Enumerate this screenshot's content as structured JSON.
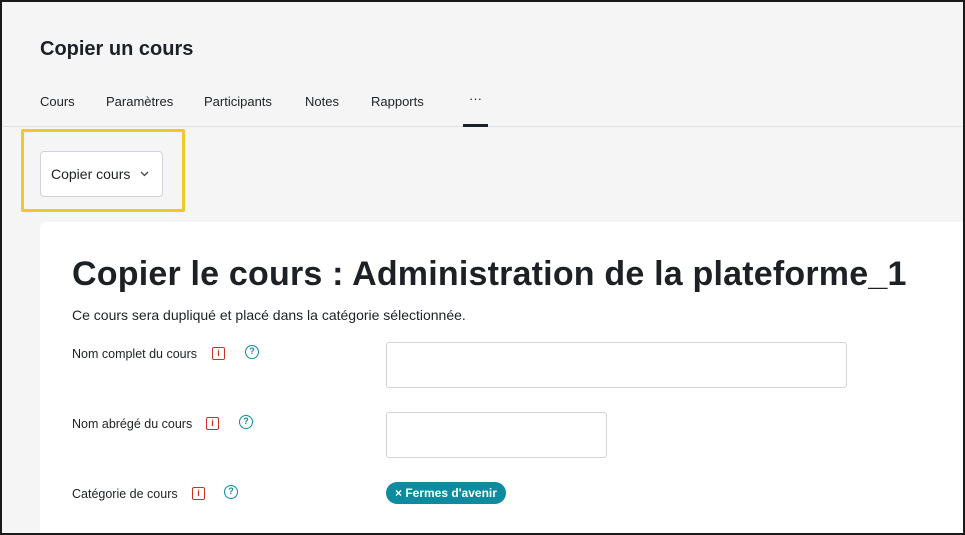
{
  "page": {
    "title": "Copier un cours"
  },
  "nav": {
    "items": [
      {
        "label": "Cours"
      },
      {
        "label": "Paramètres"
      },
      {
        "label": "Participants"
      },
      {
        "label": "Notes"
      },
      {
        "label": "Rapports"
      }
    ],
    "more_label": "···"
  },
  "action_select": {
    "label": "Copier cours",
    "chevron": "chevron-down-icon"
  },
  "main": {
    "heading": "Copier le cours : Administration de la plateforme_1",
    "description": "Ce cours sera dupliqué et placé dans la catégorie sélectionnée.",
    "fields": [
      {
        "label": "Nom complet du cours",
        "value": "",
        "required_icon": "i",
        "help_icon": "?"
      },
      {
        "label": "Nom abrégé du cours",
        "value": "",
        "required_icon": "i",
        "help_icon": "?"
      },
      {
        "label": "Catégorie de cours",
        "required_icon": "i",
        "help_icon": "?",
        "tag": "× Fermes d'avenir"
      }
    ]
  },
  "colors": {
    "accent": "#0f8ba0",
    "required": "#ca3120",
    "highlight": "#f0c929"
  }
}
